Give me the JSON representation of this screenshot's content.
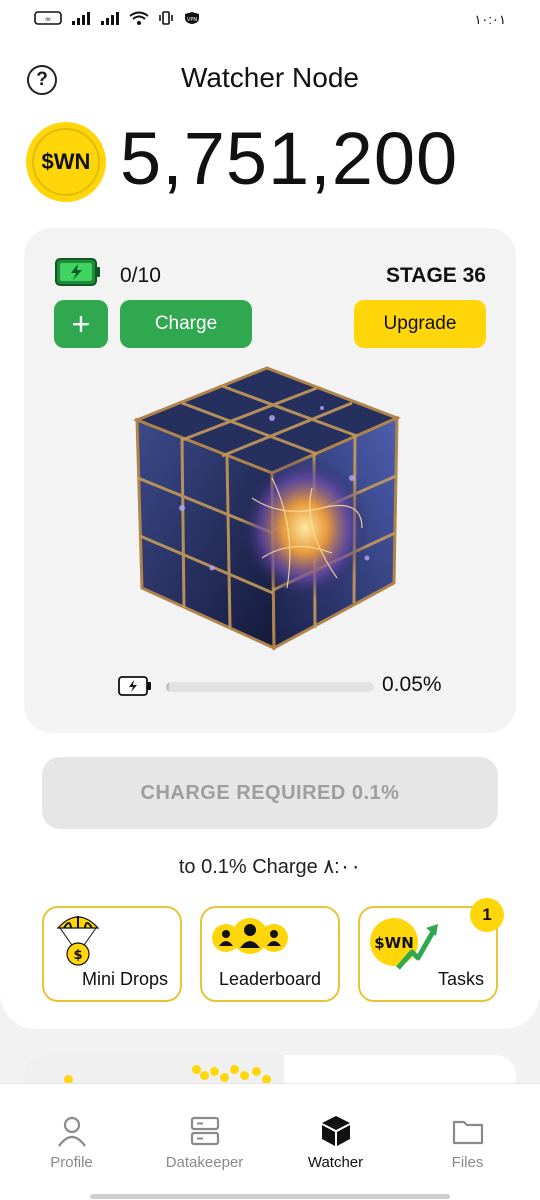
{
  "status_bar": {
    "time": "١٠:٠١",
    "icons": [
      "loop-icon",
      "signal-icon",
      "signal-icon",
      "wifi-icon",
      "vibrate-icon",
      "vpn-icon"
    ]
  },
  "header": {
    "title": "Watcher Node",
    "help_icon": "help-icon"
  },
  "balance": {
    "coin_label": "$WN",
    "amount": "5,751,200"
  },
  "node_card": {
    "charges": "0/10",
    "stage": "STAGE 36",
    "plus_label": "+",
    "charge_button": "Charge",
    "upgrade_button": "Upgrade",
    "progress_percent": 0.05,
    "progress_text": "0.05%"
  },
  "charge_required": "CHARGE REQUIRED 0.1%",
  "timer_note": "to 0.1% Charge ٨:٠٠",
  "tiles": [
    {
      "label": "Mini Drops",
      "icon": "parachute-coin-icon"
    },
    {
      "label": "Leaderboard",
      "icon": "users-icon"
    },
    {
      "label": "Tasks",
      "icon": "wn-growth-icon",
      "badge": "1"
    }
  ],
  "tasks_coin_label": "$WN",
  "bottom_nav": [
    {
      "label": "Profile",
      "icon": "user-icon",
      "active": false
    },
    {
      "label": "Datakeeper",
      "icon": "server-icon",
      "active": false
    },
    {
      "label": "Watcher",
      "icon": "cube-icon",
      "active": true
    },
    {
      "label": "Files",
      "icon": "folder-icon",
      "active": false
    }
  ],
  "colors": {
    "accent_yellow": "#ffd60a",
    "accent_green": "#2fa84f",
    "disabled_gray": "#e6e6e6"
  }
}
